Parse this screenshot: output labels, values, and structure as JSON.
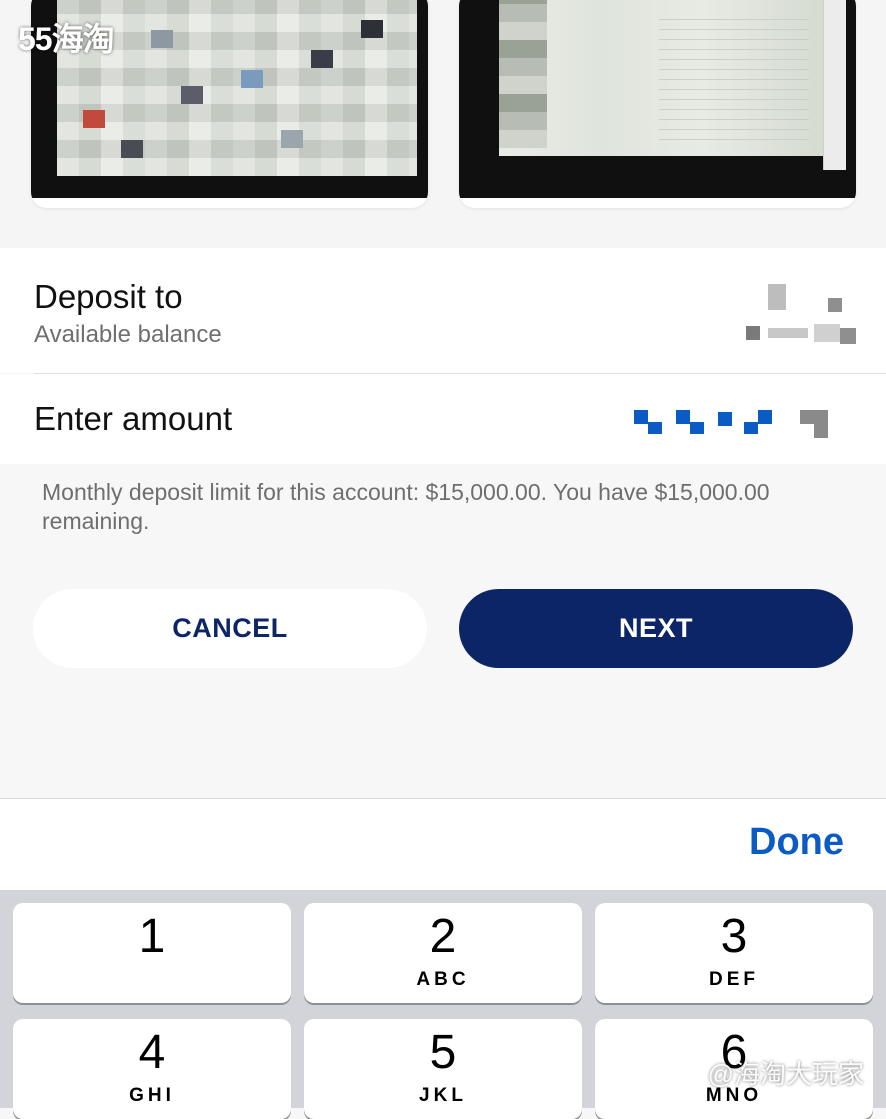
{
  "watermark_top": "55海淘",
  "watermark_bottom": "@海淘大玩家",
  "deposit": {
    "title": "Deposit to",
    "subtitle": "Available balance"
  },
  "amount": {
    "label": "Enter amount"
  },
  "limit_message": "Monthly deposit limit for this account: $15,000.00. You have $15,000.00 remaining.",
  "buttons": {
    "cancel": "CANCEL",
    "next": "NEXT"
  },
  "toolbar": {
    "done": "Done"
  },
  "keypad": [
    {
      "num": "1",
      "letters": ""
    },
    {
      "num": "2",
      "letters": "ABC"
    },
    {
      "num": "3",
      "letters": "DEF"
    },
    {
      "num": "4",
      "letters": "GHI"
    },
    {
      "num": "5",
      "letters": "JKL"
    },
    {
      "num": "6",
      "letters": "MNO"
    }
  ],
  "colors": {
    "primary": "#0b2566",
    "done_blue": "#0a5bc4",
    "masked_blue": "#0a5bc4"
  }
}
